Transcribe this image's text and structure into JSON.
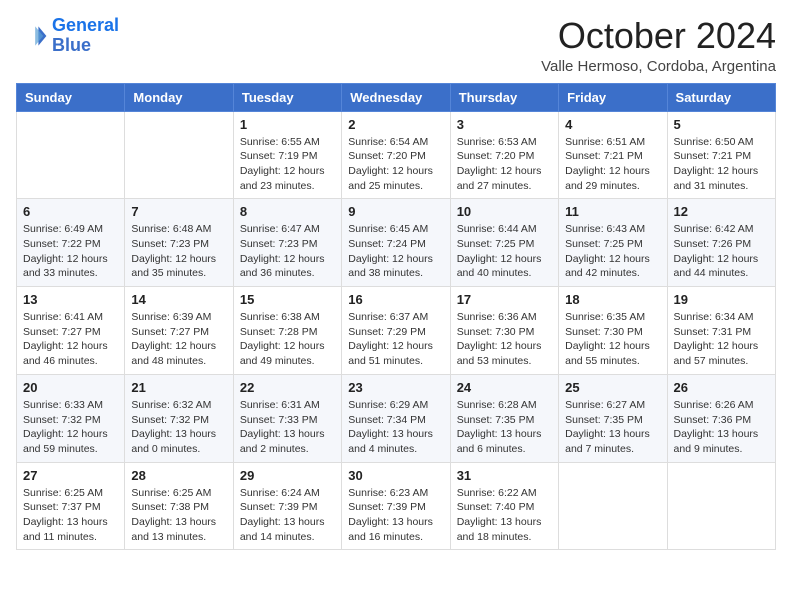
{
  "logo": {
    "line1": "General",
    "line2": "Blue"
  },
  "title": "October 2024",
  "location": "Valle Hermoso, Cordoba, Argentina",
  "weekdays": [
    "Sunday",
    "Monday",
    "Tuesday",
    "Wednesday",
    "Thursday",
    "Friday",
    "Saturday"
  ],
  "weeks": [
    [
      {
        "day": "",
        "info": ""
      },
      {
        "day": "",
        "info": ""
      },
      {
        "day": "1",
        "info": "Sunrise: 6:55 AM\nSunset: 7:19 PM\nDaylight: 12 hours and 23 minutes."
      },
      {
        "day": "2",
        "info": "Sunrise: 6:54 AM\nSunset: 7:20 PM\nDaylight: 12 hours and 25 minutes."
      },
      {
        "day": "3",
        "info": "Sunrise: 6:53 AM\nSunset: 7:20 PM\nDaylight: 12 hours and 27 minutes."
      },
      {
        "day": "4",
        "info": "Sunrise: 6:51 AM\nSunset: 7:21 PM\nDaylight: 12 hours and 29 minutes."
      },
      {
        "day": "5",
        "info": "Sunrise: 6:50 AM\nSunset: 7:21 PM\nDaylight: 12 hours and 31 minutes."
      }
    ],
    [
      {
        "day": "6",
        "info": "Sunrise: 6:49 AM\nSunset: 7:22 PM\nDaylight: 12 hours and 33 minutes."
      },
      {
        "day": "7",
        "info": "Sunrise: 6:48 AM\nSunset: 7:23 PM\nDaylight: 12 hours and 35 minutes."
      },
      {
        "day": "8",
        "info": "Sunrise: 6:47 AM\nSunset: 7:23 PM\nDaylight: 12 hours and 36 minutes."
      },
      {
        "day": "9",
        "info": "Sunrise: 6:45 AM\nSunset: 7:24 PM\nDaylight: 12 hours and 38 minutes."
      },
      {
        "day": "10",
        "info": "Sunrise: 6:44 AM\nSunset: 7:25 PM\nDaylight: 12 hours and 40 minutes."
      },
      {
        "day": "11",
        "info": "Sunrise: 6:43 AM\nSunset: 7:25 PM\nDaylight: 12 hours and 42 minutes."
      },
      {
        "day": "12",
        "info": "Sunrise: 6:42 AM\nSunset: 7:26 PM\nDaylight: 12 hours and 44 minutes."
      }
    ],
    [
      {
        "day": "13",
        "info": "Sunrise: 6:41 AM\nSunset: 7:27 PM\nDaylight: 12 hours and 46 minutes."
      },
      {
        "day": "14",
        "info": "Sunrise: 6:39 AM\nSunset: 7:27 PM\nDaylight: 12 hours and 48 minutes."
      },
      {
        "day": "15",
        "info": "Sunrise: 6:38 AM\nSunset: 7:28 PM\nDaylight: 12 hours and 49 minutes."
      },
      {
        "day": "16",
        "info": "Sunrise: 6:37 AM\nSunset: 7:29 PM\nDaylight: 12 hours and 51 minutes."
      },
      {
        "day": "17",
        "info": "Sunrise: 6:36 AM\nSunset: 7:30 PM\nDaylight: 12 hours and 53 minutes."
      },
      {
        "day": "18",
        "info": "Sunrise: 6:35 AM\nSunset: 7:30 PM\nDaylight: 12 hours and 55 minutes."
      },
      {
        "day": "19",
        "info": "Sunrise: 6:34 AM\nSunset: 7:31 PM\nDaylight: 12 hours and 57 minutes."
      }
    ],
    [
      {
        "day": "20",
        "info": "Sunrise: 6:33 AM\nSunset: 7:32 PM\nDaylight: 12 hours and 59 minutes."
      },
      {
        "day": "21",
        "info": "Sunrise: 6:32 AM\nSunset: 7:32 PM\nDaylight: 13 hours and 0 minutes."
      },
      {
        "day": "22",
        "info": "Sunrise: 6:31 AM\nSunset: 7:33 PM\nDaylight: 13 hours and 2 minutes."
      },
      {
        "day": "23",
        "info": "Sunrise: 6:29 AM\nSunset: 7:34 PM\nDaylight: 13 hours and 4 minutes."
      },
      {
        "day": "24",
        "info": "Sunrise: 6:28 AM\nSunset: 7:35 PM\nDaylight: 13 hours and 6 minutes."
      },
      {
        "day": "25",
        "info": "Sunrise: 6:27 AM\nSunset: 7:35 PM\nDaylight: 13 hours and 7 minutes."
      },
      {
        "day": "26",
        "info": "Sunrise: 6:26 AM\nSunset: 7:36 PM\nDaylight: 13 hours and 9 minutes."
      }
    ],
    [
      {
        "day": "27",
        "info": "Sunrise: 6:25 AM\nSunset: 7:37 PM\nDaylight: 13 hours and 11 minutes."
      },
      {
        "day": "28",
        "info": "Sunrise: 6:25 AM\nSunset: 7:38 PM\nDaylight: 13 hours and 13 minutes."
      },
      {
        "day": "29",
        "info": "Sunrise: 6:24 AM\nSunset: 7:39 PM\nDaylight: 13 hours and 14 minutes."
      },
      {
        "day": "30",
        "info": "Sunrise: 6:23 AM\nSunset: 7:39 PM\nDaylight: 13 hours and 16 minutes."
      },
      {
        "day": "31",
        "info": "Sunrise: 6:22 AM\nSunset: 7:40 PM\nDaylight: 13 hours and 18 minutes."
      },
      {
        "day": "",
        "info": ""
      },
      {
        "day": "",
        "info": ""
      }
    ]
  ]
}
